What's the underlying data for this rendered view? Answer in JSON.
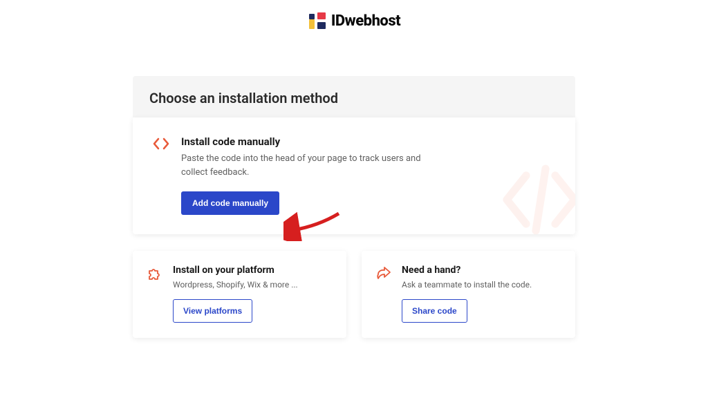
{
  "brand": "IDwebhost",
  "panel": {
    "title": "Choose an installation method"
  },
  "main": {
    "title": "Install code manually",
    "desc": "Paste the code into the head of your page to track users and collect feedback.",
    "cta": "Add code manually"
  },
  "platform": {
    "title": "Install on your platform",
    "desc": "Wordpress, Shopify, Wix & more ...",
    "cta": "View platforms"
  },
  "help": {
    "title": "Need a hand?",
    "desc": "Ask a teammate to install the code.",
    "cta": "Share code"
  }
}
